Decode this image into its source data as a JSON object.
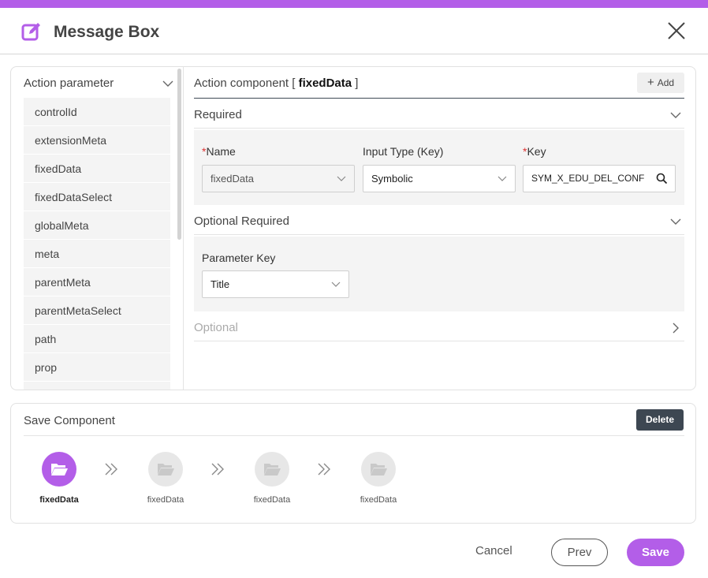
{
  "dialog": {
    "title": "Message Box",
    "accent_color": "#b35ee8"
  },
  "action_parameter": {
    "header": "Action parameter",
    "items": [
      {
        "label": "controlId"
      },
      {
        "label": "extensionMeta"
      },
      {
        "label": "fixedData"
      },
      {
        "label": "fixedDataSelect"
      },
      {
        "label": "globalMeta"
      },
      {
        "label": "meta"
      },
      {
        "label": "parentMeta"
      },
      {
        "label": "parentMetaSelect"
      },
      {
        "label": "path"
      },
      {
        "label": "prop"
      }
    ]
  },
  "action_component": {
    "title_prefix": "Action component [ ",
    "name": "fixedData",
    "title_suffix": " ]",
    "add_label": "Add",
    "required": {
      "label": "Required",
      "fields": {
        "name_label": "Name",
        "name_value": "fixedData",
        "input_type_label": "Input Type (Key)",
        "input_type_value": "Symbolic",
        "key_label": "Key",
        "key_value": "SYM_X_EDU_DEL_CONF",
        "required_mark": "*"
      }
    },
    "optional_required": {
      "label": "Optional Required",
      "parameter_key_label": "Parameter Key",
      "parameter_key_value": "Title"
    },
    "optional": {
      "label": "Optional"
    }
  },
  "save_component": {
    "title": "Save Component",
    "delete_label": "Delete",
    "steps": [
      {
        "label": "fixedData",
        "active": true
      },
      {
        "label": "fixedData",
        "active": false
      },
      {
        "label": "fixedData",
        "active": false
      },
      {
        "label": "fixedData",
        "active": false
      }
    ]
  },
  "footer": {
    "cancel_label": "Cancel",
    "prev_label": "Prev",
    "save_label": "Save"
  }
}
